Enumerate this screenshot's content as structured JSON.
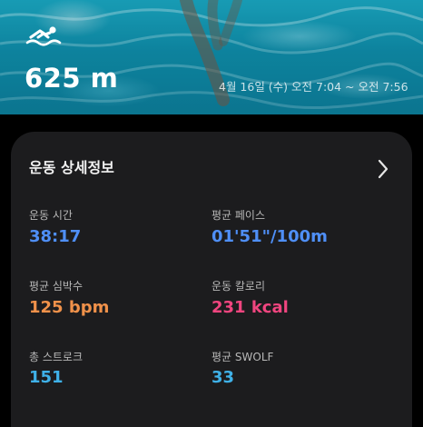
{
  "hero": {
    "distance": "625 m",
    "session_time": "4월 16일 (수) 오전 7:04 ~ 오전 7:56",
    "activity_icon": "swimmer-icon"
  },
  "card": {
    "title": "운동 상세정보",
    "more_icon": "chevron-right-icon"
  },
  "metrics": [
    {
      "label": "운동 시간",
      "value": "38:17",
      "color": "#4f8ff7"
    },
    {
      "label": "평균 페이스",
      "value": "01'51\"/100m",
      "color": "#4f8ff7"
    },
    {
      "label": "평균 심박수",
      "value": "125 bpm",
      "color": "#f0914a"
    },
    {
      "label": "운동 칼로리",
      "value": "231 kcal",
      "color": "#f0457f"
    },
    {
      "label": "총 스트로크",
      "value": "151",
      "color": "#3fb1e8"
    },
    {
      "label": "평균 SWOLF",
      "value": "33",
      "color": "#3fb1e8"
    }
  ]
}
